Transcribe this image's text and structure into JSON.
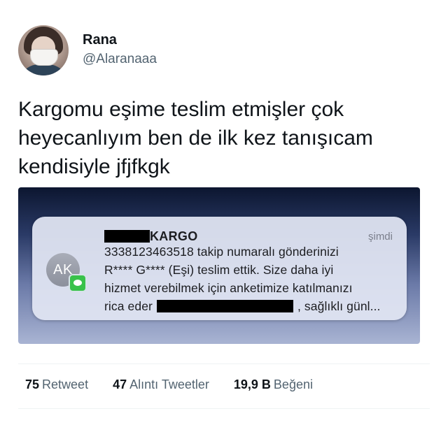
{
  "author": {
    "display_name": "Rana",
    "handle": "@Alaranaaa"
  },
  "tweet": {
    "text_lines": [
      "Kargomu eşime teslim etmişler çok",
      "heyecanlıyım ben de ilk kez tanışıcam",
      "kendisiyle jfjfkgk"
    ]
  },
  "notification": {
    "icon_initials": "AK",
    "sender": "KARGO",
    "time": "şimdi",
    "lines": [
      "3338123463518 takip numaralı gönderinizi",
      "R**** G**** (Eşi) teslim ettik. Size daha iyi",
      "hizmet verebilmek için anketimize katılmanızı"
    ],
    "last_line_start": "rica eder",
    "last_line_end": ", sağlıklı günl..."
  },
  "stats": {
    "retweets": {
      "count": "75",
      "label": "Retweet"
    },
    "quotes": {
      "count": "47",
      "label": "Alıntı Tweetler"
    },
    "likes": {
      "count": "19,9 B",
      "label": "Beğeni"
    }
  },
  "colors": {
    "text_primary": "#0f1419",
    "text_secondary": "#536471",
    "message_badge": "#39c24b"
  }
}
